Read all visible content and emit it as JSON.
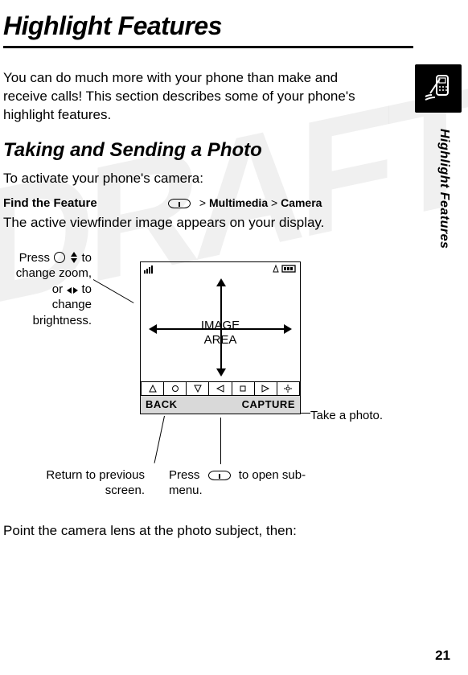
{
  "title": "Highlight Features",
  "intro": "You can do much more with your phone than make and receive calls! This section describes some of your phone's highlight features.",
  "section1": "Taking and Sending a Photo",
  "activate_line": "To activate your phone's camera:",
  "find_feature_label": "Find the Feature",
  "nav": {
    "gt1": ">",
    "step1": "Multimedia",
    "gt2": ">",
    "step2": "Camera"
  },
  "viewfinder_line": "The active viewfinder image appears on your display.",
  "callouts": {
    "zoom": {
      "l1": "Press",
      "l2": "to",
      "l3": "change zoom,",
      "l4": "or",
      "l5": "to",
      "l6": "change",
      "l7": "brightness."
    },
    "take": "Take a photo.",
    "return": {
      "l1": "Return to previous",
      "l2": "screen."
    },
    "submenu": {
      "l1": "Press",
      "l2": "to open sub-",
      "l3": "menu."
    }
  },
  "screen": {
    "image_area_l1": "IMAGE",
    "image_area_l2": "AREA",
    "soft_left": "BACK",
    "soft_right": "CAPTURE"
  },
  "closing": "Point the camera lens at the photo subject, then:",
  "side_tab": "Highlight Features",
  "page_number": "21"
}
